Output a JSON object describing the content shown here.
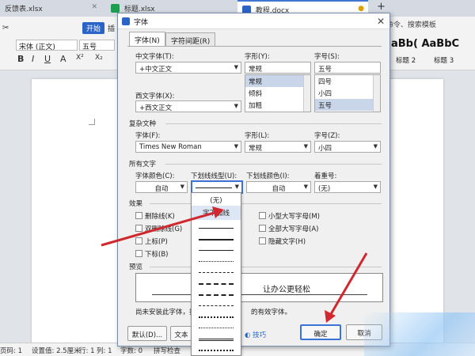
{
  "tabs": [
    {
      "label": "反馈表.xlsx",
      "color": "#1f9b52"
    },
    {
      "label": "标题.xlsx",
      "color": "#1f9b52"
    },
    {
      "label": "教程.docx",
      "color": "#2c63c7"
    }
  ],
  "tab_add": "+",
  "search_hint": "命令、搜索模板",
  "ribbon": {
    "start": "开始",
    "insert": "插",
    "font_family": "宋体 (正文)",
    "font_size": "五号",
    "format_buttons": [
      "B",
      "I",
      "U",
      "A",
      "X²",
      "X₂"
    ],
    "style_preview": "aBb( AaBbC",
    "style_labels": [
      "标题 2",
      "标题 3"
    ]
  },
  "status": {
    "page": "页码: 1",
    "pages": "页面: 1/1",
    "section": "节: 1/1",
    "setting": "设置值: 2.5厘米",
    "row": "行: 1",
    "col": "列: 1",
    "words": "字数: 0",
    "spell": "拼写检查"
  },
  "dialog": {
    "title": "字体",
    "close": "✕",
    "tabs": [
      "字体(N)",
      "字符间距(R)"
    ],
    "cn_font_label": "中文字体(T):",
    "cn_font_value": "+中文正文",
    "style_label": "字形(Y):",
    "style_value": "常规",
    "style_list": [
      "常规",
      "倾斜",
      "加粗"
    ],
    "size_label": "字号(S):",
    "size_value": "五号",
    "size_list": [
      "四号",
      "小四",
      "五号"
    ],
    "west_font_label": "西文字体(X):",
    "west_font_value": "+西文正文",
    "complex_section": "复杂文种",
    "complex_font_label": "字体(F):",
    "complex_font_value": "Times New Roman",
    "complex_style_label": "字形(L):",
    "complex_style_value": "常规",
    "complex_size_label": "字号(Z):",
    "complex_size_value": "小四",
    "all_text_section": "所有文字",
    "color_label": "字体颜色(C):",
    "color_value": "自动",
    "underline_label": "下划线线型(U):",
    "underline_color_label": "下划线颜色(I):",
    "underline_color_value": "自动",
    "emphasis_label": "着重号:",
    "emphasis_value": "(无)",
    "effects_section": "效果",
    "effects_left": [
      "删除线(K)",
      "双删除线(G)",
      "上标(P)",
      "下标(B)"
    ],
    "effects_right": [
      "小型大写字母(M)",
      "全部大写字母(A)",
      "隐藏文字(H)"
    ],
    "preview_section": "预览",
    "preview_text": "让办公更轻松",
    "note": "尚未安装此字体，打",
    "note_tail": "的有效字体。",
    "default_btn": "默认(D)...",
    "text_effects_btn": "文本",
    "tips_link": "技巧",
    "ok_btn": "确定",
    "cancel_btn": "取消"
  },
  "underline_dropdown": {
    "items": [
      "(无)",
      "字下加线"
    ],
    "line_styles": [
      "solid",
      "thick",
      "solid-thin",
      "dotted",
      "dashed",
      "dashed-thick",
      "dash-long",
      "dash-dot",
      "dash-dot-thick",
      "dash-dot-dot",
      "double",
      "wave"
    ]
  },
  "colors": {
    "accent": "#3a72d6",
    "arrow": "#d0282e",
    "start_button": "#2c63c7"
  }
}
